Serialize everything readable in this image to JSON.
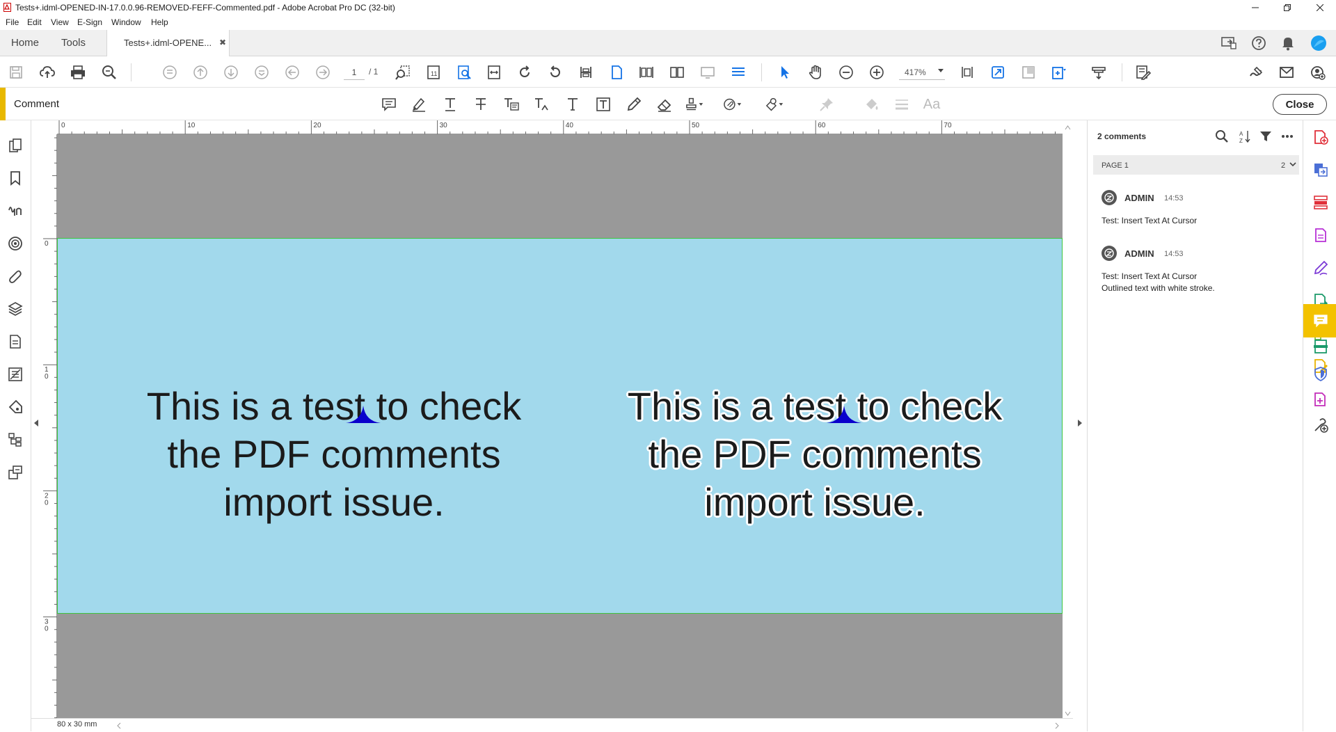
{
  "window": {
    "title": "Tests+.idml-OPENED-IN-17.0.0.96-REMOVED-FEFF-Commented.pdf - Adobe Acrobat Pro DC (32-bit)"
  },
  "menu": [
    "File",
    "Edit",
    "View",
    "E-Sign",
    "Window",
    "Help"
  ],
  "tabs": {
    "home": "Home",
    "tools": "Tools",
    "document": "Tests+.idml-OPENE...",
    "document_close": "✖"
  },
  "toolbar": {
    "page_current": "1",
    "page_total": "/ 1",
    "zoom": "417%"
  },
  "comment_bar": {
    "label": "Comment",
    "close_label": "Close",
    "text_style_label": "Aa"
  },
  "ruler": {
    "h_labels": [
      "0",
      "10",
      "20",
      "30",
      "40",
      "50",
      "60",
      "70"
    ],
    "v_labels": [
      "0",
      "1\n0",
      "2\n0",
      "3\n0"
    ]
  },
  "document": {
    "text_plain": "This is a test to check the PDF comments import issue.",
    "text_outlined": "This is a test to check the PDF comments import issue.",
    "page_size": "80 x 30 mm"
  },
  "comments_panel": {
    "count_label": "2 comments",
    "page_label": "PAGE 1",
    "page_count": "2",
    "comments": [
      {
        "author": "ADMIN",
        "time": "14:53",
        "lines": [
          "Test: Insert Text At Cursor"
        ]
      },
      {
        "author": "ADMIN",
        "time": "14:53",
        "lines": [
          "Test: Insert Text At Cursor",
          "Outlined text with white stroke."
        ]
      }
    ]
  },
  "colors": {
    "page_bg": "#a2d9ec",
    "canvas_bg": "#999999",
    "accent": "#f3c200",
    "caret": "#0000cc"
  }
}
